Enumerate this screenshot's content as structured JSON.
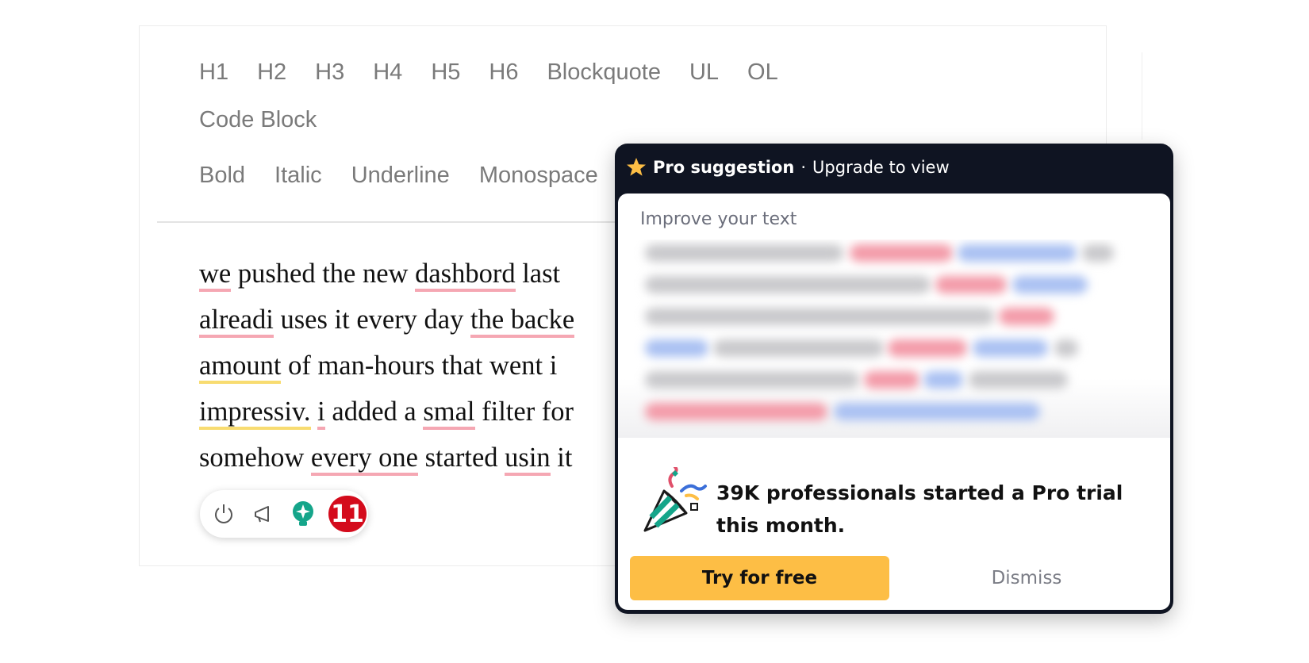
{
  "toolbar": {
    "block_formats": [
      "H1",
      "H2",
      "H3",
      "H4",
      "H5",
      "H6",
      "Blockquote",
      "UL",
      "OL"
    ],
    "code_block": "Code Block",
    "inline_formats": [
      "Bold",
      "Italic",
      "Underline",
      "Monospace"
    ]
  },
  "content": {
    "lines": [
      [
        {
          "t": "we",
          "m": "err"
        },
        {
          "t": " pushed the new "
        },
        {
          "t": "dashbord",
          "m": "err"
        },
        {
          "t": " last"
        }
      ],
      [
        {
          "t": "alreadi",
          "m": "err"
        },
        {
          "t": " uses it every day "
        },
        {
          "t": "the backe",
          "m": "err"
        }
      ],
      [
        {
          "t": "amount",
          "m": "warn"
        },
        {
          "t": " of man-hours that went i"
        }
      ],
      [
        {
          "t": "impressiv.",
          "m": "warn"
        },
        {
          "t": " "
        },
        {
          "t": "i",
          "m": "err"
        },
        {
          "t": " added a "
        },
        {
          "t": "smal",
          "m": "err"
        },
        {
          "t": " filter for"
        }
      ],
      [
        {
          "t": "somehow "
        },
        {
          "t": "every one",
          "m": "err"
        },
        {
          "t": " started "
        },
        {
          "t": "usin",
          "m": "err"
        },
        {
          "t": " it"
        }
      ]
    ]
  },
  "widget": {
    "icons": [
      "power-icon",
      "megaphone-icon",
      "lightbulb-sparkle-icon"
    ],
    "issue_count": "11",
    "badge_color": "#d40b1c",
    "bulb_color": "#15a58a"
  },
  "popup": {
    "header_title": "Pro suggestion",
    "header_separator": "·",
    "header_action": "Upgrade to view",
    "section_label": "Improve your text",
    "promo_text": "39K professionals started a Pro trial this month.",
    "primary_button": "Try for free",
    "secondary_button": "Dismiss",
    "accent_color": "#fdbe45",
    "header_bg": "#0f1422"
  }
}
